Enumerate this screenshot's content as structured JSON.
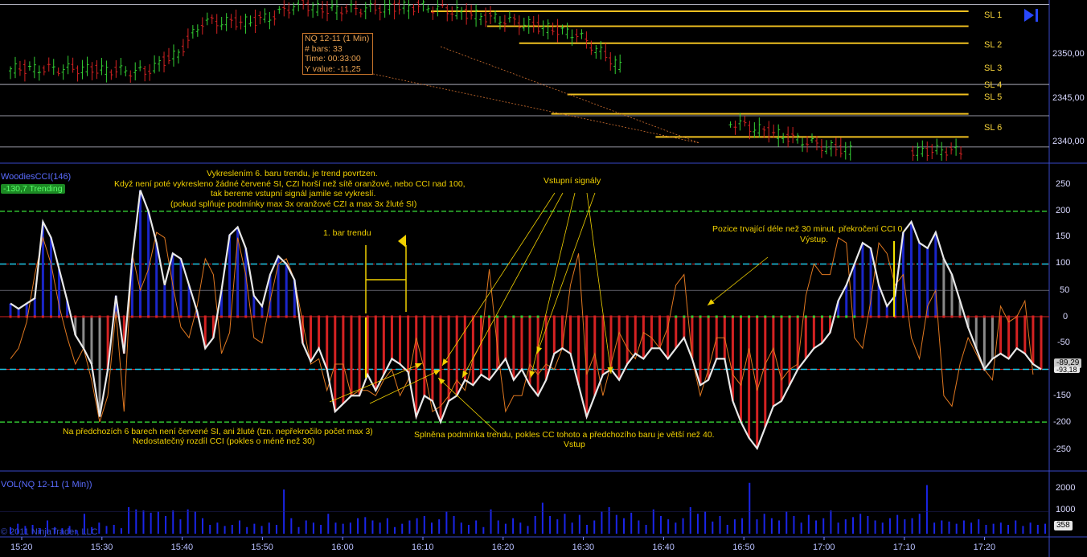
{
  "chart_data": [
    {
      "type": "candlestick",
      "title": "",
      "instrument": "NQ 12-11 (1 Min)",
      "y_ticks": [
        "2340,00",
        "2345,00",
        "2350,00"
      ],
      "ylim": [
        2337.8,
        2363.5
      ],
      "levels": [
        {
          "name": "SL 1",
          "value": 2361.7,
          "x_start": "16:11",
          "x_end": "17:18"
        },
        {
          "name": "SL 2",
          "value": 2359.3,
          "x_start": "16:18",
          "x_end": "17:18"
        },
        {
          "name": "SL 3",
          "value": 2356.6,
          "x_start": "16:22",
          "x_end": "17:18"
        },
        {
          "name": "SL 4",
          "value": 2348.4,
          "x_start": "16:28",
          "x_end": "17:18"
        },
        {
          "name": "SL 5",
          "value": 2345.3,
          "x_start": "16:26",
          "x_end": "17:18"
        },
        {
          "name": "SL 6",
          "value": 2341.6,
          "x_start": "16:39",
          "x_end": "17:18"
        }
      ],
      "gridlines": [
        2362.8,
        2350,
        2345,
        2340
      ],
      "tooltip": {
        "title": "NQ 12-11 (1 Min)",
        "bars_label": "# bars:",
        "bars_value": "33",
        "time_label": "Time:",
        "time_value": "00:33:00",
        "yvalue_label": "Y value:",
        "yvalue_value": "-11,25"
      }
    },
    {
      "type": "bar-line",
      "title": "WoodiesCCI(146)",
      "badge": "-130,7 Trending",
      "y_ticks": [
        "250",
        "200",
        "150",
        "100",
        "50",
        "0",
        "-50",
        "-150",
        "-200",
        "-250"
      ],
      "ylim": [
        -280,
        265
      ],
      "current_values": [
        "-89,29",
        "-93,18"
      ],
      "reference_lines": [
        200,
        100,
        0,
        -100,
        -200
      ],
      "series": [
        {
          "name": "CCI",
          "color": "#e8e8e8",
          "values": [
            25,
            15,
            25,
            35,
            180,
            150,
            90,
            30,
            -35,
            -60,
            -90,
            -190,
            -100,
            40,
            -70,
            110,
            240,
            200,
            140,
            60,
            120,
            110,
            60,
            10,
            -60,
            -40,
            50,
            155,
            170,
            130,
            40,
            20,
            80,
            115,
            100,
            70,
            -50,
            -85,
            -60,
            -100,
            -180,
            -165,
            -150,
            -150,
            -110,
            -140,
            -110,
            -80,
            -90,
            -105,
            -190,
            -150,
            -160,
            -200,
            -160,
            -150,
            -120,
            -130,
            -110,
            -120,
            -100,
            -80,
            -120,
            -100,
            -130,
            -150,
            -120,
            -70,
            -60,
            -70,
            -130,
            -190,
            -150,
            -110,
            -100,
            -120,
            -90,
            -70,
            -80,
            -60,
            -60,
            -80,
            -60,
            -40,
            -80,
            -130,
            -120,
            -80,
            -80,
            -160,
            -200,
            -230,
            -250,
            -210,
            -170,
            -160,
            -130,
            -100,
            -80,
            -60,
            -50,
            -30,
            30,
            60,
            100,
            140,
            130,
            60,
            20,
            40,
            160,
            180,
            140,
            130,
            160,
            110,
            80,
            30,
            -20,
            -60,
            -100,
            -80,
            -70,
            -80,
            -60,
            -70,
            -90,
            -100
          ]
        },
        {
          "name": "Turbo CCI",
          "color": "#e07820",
          "values": [
            -80,
            -60,
            -10,
            80,
            150,
            100,
            20,
            -40,
            -90,
            -60,
            -120,
            -200,
            -150,
            10,
            -180,
            120,
            50,
            90,
            160,
            150,
            60,
            -20,
            -40,
            20,
            110,
            80,
            -70,
            -30,
            150,
            80,
            -40,
            -50,
            30,
            100,
            110,
            70,
            -10,
            -90,
            -80,
            -140,
            -90,
            -90,
            -150,
            -140,
            -140,
            -150,
            -120,
            -100,
            -150,
            -120,
            -40,
            -100,
            -180,
            -170,
            -150,
            -120,
            -140,
            -80,
            -50,
            90,
            -60,
            -180,
            -150,
            -150,
            -90,
            -110,
            -90,
            -100,
            -60,
            60,
            120,
            -110,
            -70,
            -150,
            -90,
            -30,
            -60,
            -80,
            -30,
            -40,
            -60,
            -20,
            60,
            80,
            -80,
            -150,
            -100,
            -40,
            -40,
            -110,
            -130,
            -60,
            -140,
            -90,
            -60,
            -120,
            -100,
            -90,
            40,
            100,
            80,
            80,
            150,
            140,
            -40,
            -60,
            30,
            140,
            120,
            60,
            80,
            -40,
            -80,
            20,
            50,
            -150,
            -170,
            -90,
            -40,
            -70,
            -100,
            -120,
            20,
            -10,
            0,
            30,
            -110
          ]
        }
      ],
      "annotations": [
        {
          "text": "Vykreslením 6. baru trendu, je trend povrtzen."
        },
        {
          "text": "Když není poté vykresleno žádné červené SI, CZI horší než sítě oranžové, nebo CCI nad 100,"
        },
        {
          "text": "tak bereme vstupní signál jamile se vykreslí."
        },
        {
          "text": "(pokud splňuje podmínky max 3x oranžové CZI a max 3x žluté SI)"
        },
        {
          "text": "1. bar trendu"
        },
        {
          "text": "Vstupní signály"
        },
        {
          "text": "Pozice trvající déle než 30 minut, překročení CCI 0."
        },
        {
          "text": "Výstup."
        },
        {
          "text": "Na předchozích 6 barech není červené SI, ani žluté (tzn. nepřekročilo počet max 3)"
        },
        {
          "text": "Nedostatečný rozdíl CCI (pokles o méně než 30)"
        },
        {
          "text": "Splněna podmínka trendu, pokles CC tohoto a předchozího baru je větší než 40."
        },
        {
          "text": "Vstup"
        }
      ]
    },
    {
      "type": "bar",
      "title": "VOL(NQ 12-11 (1 Min))",
      "y_ticks": [
        "2000",
        "1000",
        "500"
      ],
      "ylim": [
        0,
        2300
      ],
      "current_value": "358",
      "values": [
        300,
        450,
        350,
        400,
        250,
        600,
        300,
        250,
        350,
        150,
        900,
        300,
        500,
        350,
        400,
        250,
        1200,
        1100,
        1050,
        950,
        1000,
        800,
        1050,
        650,
        1100,
        1000,
        700,
        400,
        500,
        350,
        400,
        600,
        300,
        450,
        350,
        500,
        400,
        2000,
        700,
        300,
        600,
        500,
        400,
        900,
        500,
        450,
        500,
        700,
        750,
        600,
        500,
        700,
        300,
        450,
        600,
        700,
        800,
        500,
        650,
        1000,
        800,
        500,
        400,
        600,
        300,
        1100,
        600,
        450,
        700,
        500,
        350,
        800,
        1400,
        800,
        650,
        900,
        500,
        850,
        400,
        600,
        1000,
        1200,
        850,
        700,
        950,
        600,
        400,
        1100,
        800,
        650,
        500,
        700,
        1200,
        900,
        1000,
        550,
        800,
        400,
        650,
        700,
        2300,
        650,
        900,
        700,
        600,
        1000,
        800,
        500,
        850,
        600,
        700,
        1050,
        500,
        650,
        750,
        900,
        800,
        600,
        500,
        700,
        850,
        650,
        700,
        900,
        2200,
        500,
        600,
        550,
        450,
        600,
        500,
        650,
        400,
        450,
        500,
        400,
        600,
        350,
        500,
        400,
        450
      ]
    }
  ],
  "x_axis": [
    "15:20",
    "15:30",
    "15:40",
    "15:50",
    "16:00",
    "16:10",
    "16:20",
    "16:30",
    "16:40",
    "16:50",
    "17:00",
    "17:10",
    "17:20"
  ],
  "copyright": "© 2011 NinjaTrader, LLC",
  "colors": {
    "cci": "#e8e8e8",
    "turbo": "#e07820",
    "trend_up": "#1a25c8",
    "trend_down": "#d42222",
    "levels": "#f0c020",
    "grid": "#3a3aa0",
    "zero_line": "#d42222",
    "blue_line": "#22c8e8",
    "volume": "#1a25e8"
  }
}
